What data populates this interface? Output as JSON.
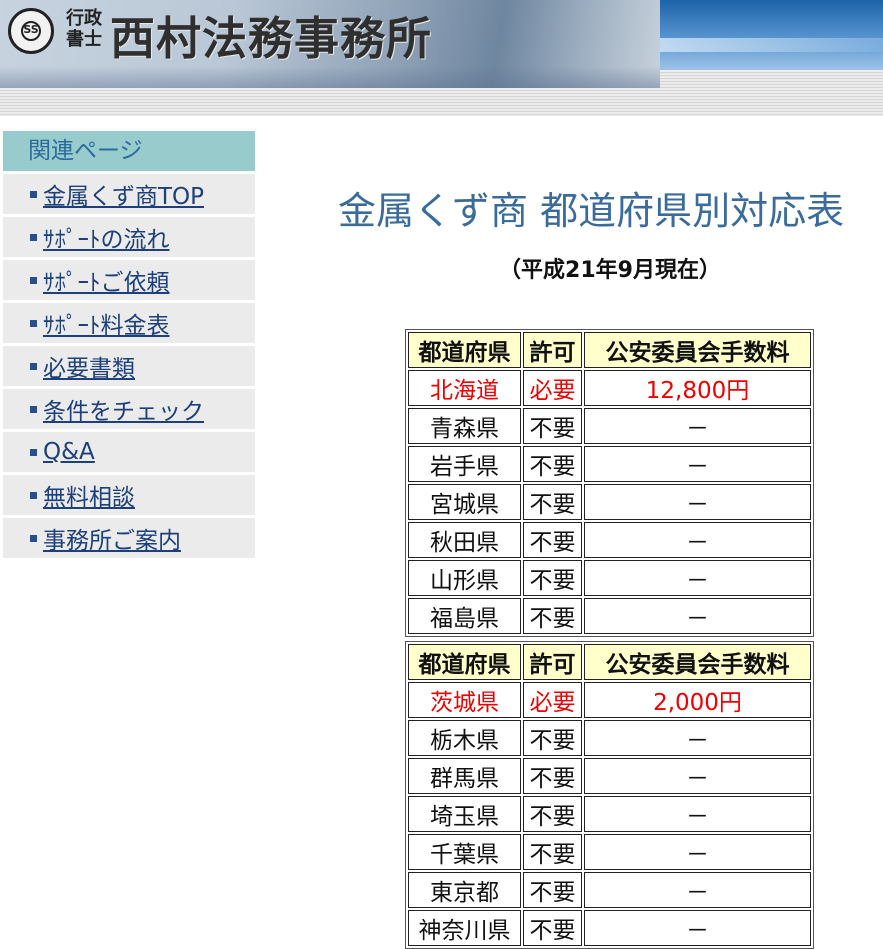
{
  "header": {
    "seal_text": "SS",
    "gyosei_line1": "行政",
    "gyosei_line2": "書士",
    "office_name": "西村法務事務所"
  },
  "sidebar": {
    "heading": "関連ページ",
    "items": [
      {
        "label": "金属くず商TOP"
      },
      {
        "label": "ｻﾎﾟｰﾄの流れ"
      },
      {
        "label": "ｻﾎﾟｰﾄご依頼"
      },
      {
        "label": "ｻﾎﾟｰﾄ料金表"
      },
      {
        "label": "必要書類"
      },
      {
        "label": "条件をチェック"
      },
      {
        "label": "Q&A"
      },
      {
        "label": "無料相談"
      },
      {
        "label": "事務所ご案内"
      }
    ]
  },
  "main": {
    "title": "金属くず商 都道府県別対応表",
    "as_of": "（平成21年9月現在）",
    "tables": [
      {
        "header": [
          "都道府県",
          "許可",
          "公安委員会手数料"
        ],
        "rows": [
          {
            "pref": "北海道",
            "permit": "必要",
            "fee": "12,800円"
          },
          {
            "pref": "青森県",
            "permit": "不要",
            "fee": "－"
          },
          {
            "pref": "岩手県",
            "permit": "不要",
            "fee": "－"
          },
          {
            "pref": "宮城県",
            "permit": "不要",
            "fee": "－"
          },
          {
            "pref": "秋田県",
            "permit": "不要",
            "fee": "－"
          },
          {
            "pref": "山形県",
            "permit": "不要",
            "fee": "－"
          },
          {
            "pref": "福島県",
            "permit": "不要",
            "fee": "－"
          }
        ]
      },
      {
        "header": [
          "都道府県",
          "許可",
          "公安委員会手数料"
        ],
        "rows": [
          {
            "pref": "茨城県",
            "permit": "必要",
            "fee": "2,000円"
          },
          {
            "pref": "栃木県",
            "permit": "不要",
            "fee": "－"
          },
          {
            "pref": "群馬県",
            "permit": "不要",
            "fee": "－"
          },
          {
            "pref": "埼玉県",
            "permit": "不要",
            "fee": "－"
          },
          {
            "pref": "千葉県",
            "permit": "不要",
            "fee": "－"
          },
          {
            "pref": "東京都",
            "permit": "不要",
            "fee": "－"
          },
          {
            "pref": "神奈川県",
            "permit": "不要",
            "fee": "－"
          }
        ]
      }
    ]
  },
  "colors": {
    "title": "#3a6b9a",
    "sidebar_heading_bg": "#98cccc",
    "table_header_bg": "#ffffcc",
    "required_text": "#ee0000"
  }
}
